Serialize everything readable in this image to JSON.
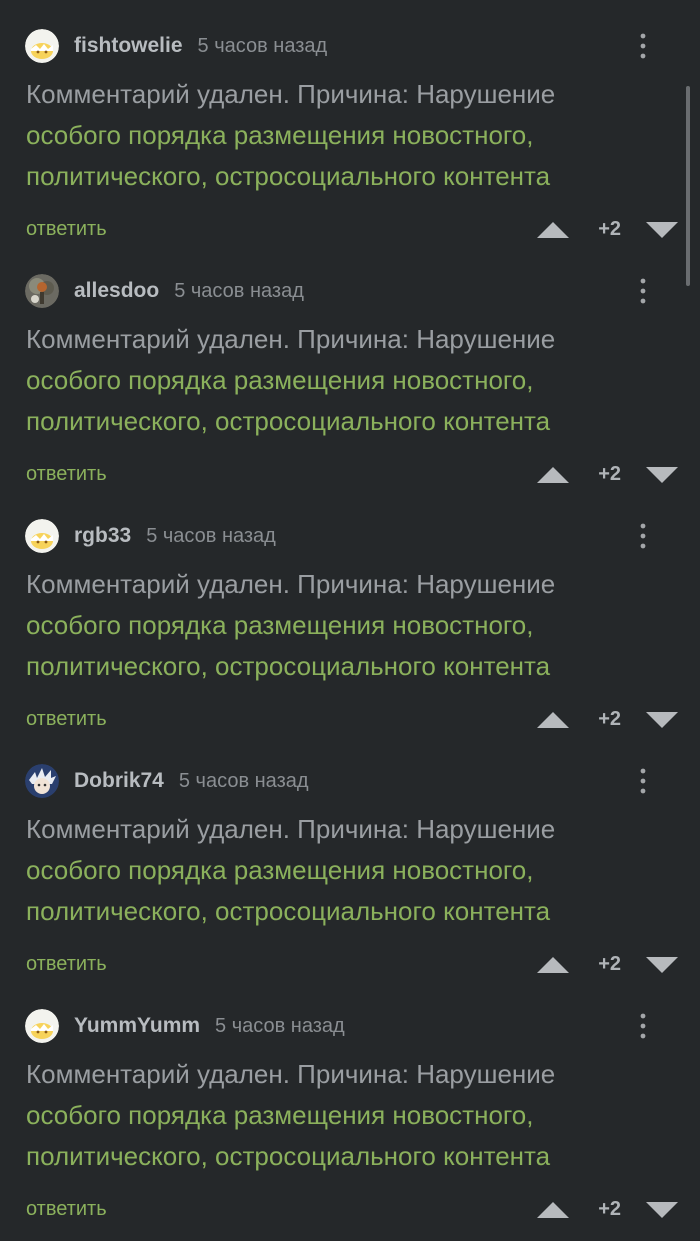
{
  "comments": [
    {
      "username": "fishtowelie",
      "time": "5 часов назад",
      "avatar_icon": "egg-yellow-avatar",
      "text_muted": "Комментарий удален. Причина: Нарушение",
      "text_link": "особого порядка размещения новостного, политического, остросоциального контента",
      "reply_label": "ответить",
      "score": "+2"
    },
    {
      "username": "allesdoo",
      "time": "5 часов назад",
      "avatar_icon": "photo-avatar-tree",
      "text_muted": "Комментарий удален. Причина: Нарушение",
      "text_link": "особого порядка размещения новостного, политического, остросоциального контента",
      "reply_label": "ответить",
      "score": "+2"
    },
    {
      "username": "rgb33",
      "time": "5 часов назад",
      "avatar_icon": "egg-yellow-avatar",
      "text_muted": "Комментарий удален. Причина: Нарушение",
      "text_link": "особого порядка размещения новостного, политического, остросоциального контента",
      "reply_label": "ответить",
      "score": "+2"
    },
    {
      "username": "Dobrik74",
      "time": "5 часов назад",
      "avatar_icon": "photo-avatar-character",
      "text_muted": "Комментарий удален. Причина: Нарушение",
      "text_link": "особого порядка размещения новостного, политического, остросоциального контента",
      "reply_label": "ответить",
      "score": "+2"
    },
    {
      "username": "YummYumm",
      "time": "5 часов назад",
      "avatar_icon": "egg-yellow-avatar",
      "text_muted": "Комментарий удален. Причина: Нарушение",
      "text_link": "особого порядка размещения новостного, политического, остросоциального контента",
      "reply_label": "ответить",
      "score": "+2"
    }
  ],
  "colors": {
    "background": "#25282a",
    "link_green": "#8bb15c",
    "muted_text": "#9a9ea2",
    "username": "#b8bcc0",
    "vote_arrow": "#b7babd"
  }
}
